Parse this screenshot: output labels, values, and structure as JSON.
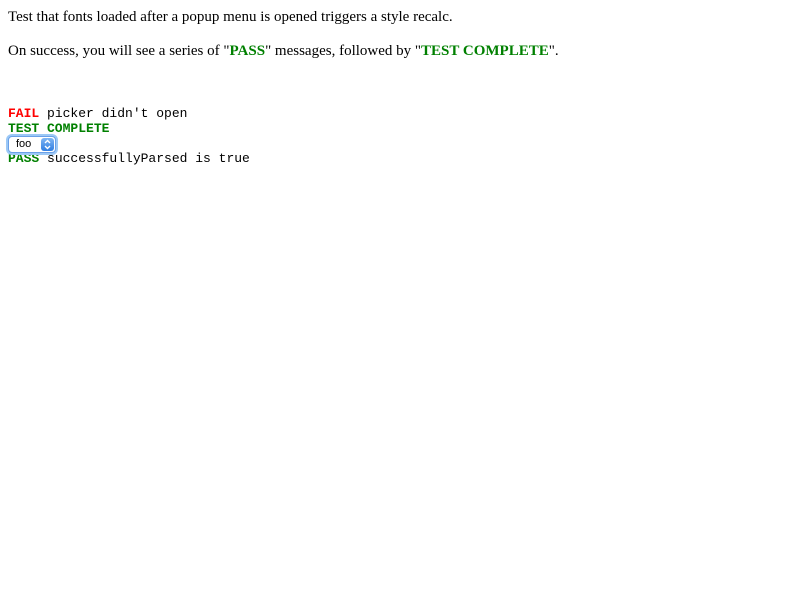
{
  "intro": {
    "line1": "Test that fonts loaded after a popup menu is opened triggers a style recalc.",
    "line2_prefix": "On success, you will see a series of \"",
    "line2_pass": "PASS",
    "line2_middle": "\" messages, followed by \"",
    "line2_complete": "TEST COMPLETE",
    "line2_suffix": "\"."
  },
  "results": [
    {
      "status": "FAIL",
      "message": " picker didn't open"
    },
    {
      "status": "PASS",
      "message": " successfullyParsed is true"
    }
  ],
  "completion": "TEST COMPLETE",
  "select": {
    "value": "foo",
    "icon": "chevron-updown-icon"
  },
  "colors": {
    "pass": "#008000",
    "fail": "#ff0000",
    "focus_ring": "#9cc8f6"
  }
}
